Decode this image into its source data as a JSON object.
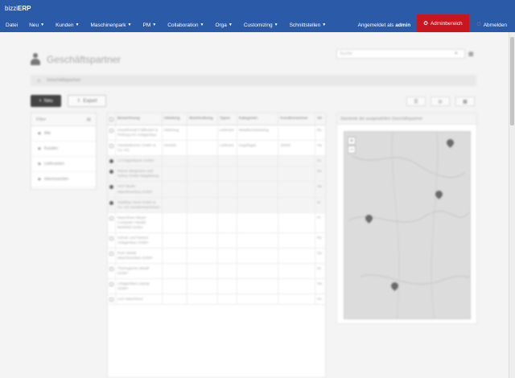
{
  "brand": {
    "prefix": "bizzi",
    "suffix": "ERP"
  },
  "nav": {
    "items": [
      "Datei",
      "Neu",
      "Kunden",
      "Maschinenpark",
      "PM",
      "Collaboration",
      "Orga",
      "Customizing",
      "Schnittstellen"
    ],
    "logged_in_prefix": "Angemeldet als",
    "logged_in_user": "admin",
    "admin_label": "Adminbereich",
    "logout_label": "Abmelden"
  },
  "page": {
    "title": "Geschäftspartner",
    "search_placeholder": "Suche",
    "breadcrumb": "Geschäftspartner",
    "new_label": "Neu",
    "export_label": "Export"
  },
  "filter": {
    "title": "Filter",
    "items": [
      "Alle",
      "Kunden",
      "Lieferanten",
      "Interessenten"
    ]
  },
  "table": {
    "headers": [
      "",
      "Bezeichnung",
      "Abteilung",
      "Beschreibung",
      "Typen",
      "Kategorien",
      "Kundennummer",
      "Str"
    ],
    "rows": [
      {
        "name": "Gesellschaft Fallbedarf & Prüfung KG Anlagenbau",
        "dept": "Abteilung",
        "desc": "",
        "typ": "Lieferant",
        "kat": "Metallverarbeitung",
        "nr": "",
        "str": "Bo",
        "mark": "off",
        "shade": false
      },
      {
        "name": "Handelskontor GmbH & Co. KG",
        "dept": "Vertrieb",
        "desc": "",
        "typ": "Lieferant",
        "kat": "Kugellager",
        "nr": "20000",
        "str": "Ha",
        "mark": "off",
        "shade": false
      },
      {
        "name": "Lo Feigenbaum GmbH",
        "dept": "",
        "desc": "",
        "typ": "",
        "kat": "",
        "nr": "",
        "str": "Fe",
        "mark": "on",
        "shade": true
      },
      {
        "name": "Rainer Bergmann und Söhne GmbH Magdeburg",
        "dept": "",
        "desc": "",
        "typ": "",
        "kat": "",
        "nr": "",
        "str": "Ke",
        "mark": "on",
        "shade": true
      },
      {
        "name": "HCP Berlin Maschinenbau GmbH",
        "dept": "",
        "desc": "",
        "typ": "",
        "kat": "",
        "nr": "",
        "str": "Ha",
        "mark": "on",
        "shade": true
      },
      {
        "name": "Stahlbau Nord GmbH & Co. KG Sondermaschinen",
        "dept": "",
        "desc": "",
        "typ": "",
        "kat": "",
        "nr": "",
        "str": "Kl",
        "mark": "on",
        "shade": true
      },
      {
        "name": "Maschinen Meyer Computer Handel Bielefeld GmbH",
        "dept": "",
        "desc": "",
        "typ": "",
        "kat": "",
        "nr": "",
        "str": "Pr",
        "mark": "off",
        "shade": false
      },
      {
        "name": "Schulz und Partner Anlagenbau GmbH",
        "dept": "",
        "desc": "",
        "typ": "",
        "kat": "",
        "nr": "",
        "str": "Ro",
        "mark": "off",
        "shade": false
      },
      {
        "name": "Ruhr Metall Maschinenbau GmbH",
        "dept": "",
        "desc": "",
        "typ": "",
        "kat": "",
        "nr": "",
        "str": "Ge",
        "mark": "off",
        "shade": false
      },
      {
        "name": "Thüringische Metall GmbH",
        "dept": "",
        "desc": "",
        "typ": "",
        "kat": "",
        "nr": "",
        "str": "Gr",
        "mark": "off",
        "shade": false
      },
      {
        "name": "Anlagenbau Leipzig GmbH",
        "dept": "",
        "desc": "",
        "typ": "",
        "kat": "",
        "nr": "",
        "str": "Ha",
        "mark": "off",
        "shade": false
      },
      {
        "name": "LUX Maschinen",
        "dept": "",
        "desc": "",
        "typ": "",
        "kat": "",
        "nr": "",
        "str": "Kn",
        "mark": "off",
        "shade": false
      }
    ]
  },
  "map": {
    "title": "Standorte der ausgewählten Geschäftspartner",
    "zoom_in": "+",
    "zoom_out": "−"
  },
  "colors": {
    "header": "#2a5aa8",
    "admin": "#c9151e"
  },
  "icons": [
    "user-icon",
    "search-icon",
    "grid-icon",
    "home-icon",
    "plus-icon",
    "export-icon",
    "filter-icon",
    "tag-icon",
    "map-pin-icon",
    "power-icon",
    "gear-icon"
  ]
}
